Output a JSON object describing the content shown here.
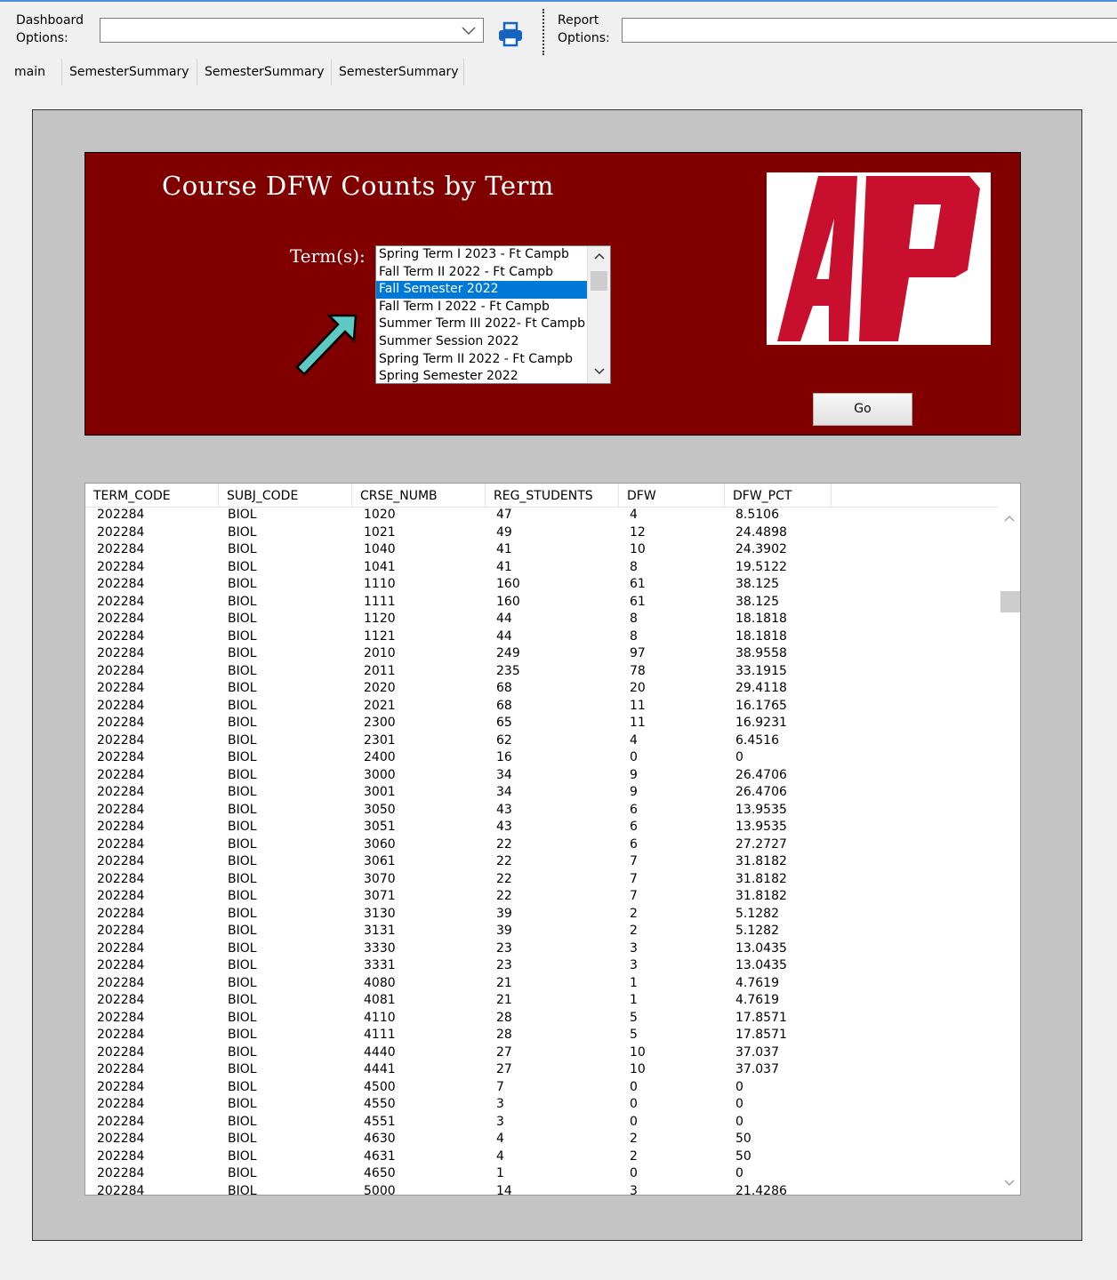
{
  "toolbar": {
    "dashboard_label_1": "Dashboard",
    "dashboard_label_2": "Options:",
    "dashboard_value": "",
    "report_label_1": "Report",
    "report_label_2": "Options:",
    "report_value": ""
  },
  "tabs": [
    "main",
    "SemesterSummary",
    "SemesterSummary",
    "SemesterSummary"
  ],
  "panel": {
    "title": "Course DFW Counts by Term",
    "terms_label": "Term(s):",
    "go_label": "Go",
    "terms": [
      "Spring Term I 2023 - Ft Campb",
      "Fall Term II 2022 - Ft Campb",
      "Fall Semester 2022",
      "Fall Term I 2022 - Ft Campb",
      "Summer Term III 2022- Ft Campb",
      "Summer Session 2022",
      "Spring Term II 2022 - Ft Campb",
      "Spring Semester 2022"
    ],
    "selected_term_index": 2,
    "accent_color": "#800000",
    "logo_color": "#c8102e"
  },
  "grid": {
    "columns": [
      "TERM_CODE",
      "SUBJ_CODE",
      "CRSE_NUMB",
      "REG_STUDENTS",
      "DFW",
      "DFW_PCT"
    ],
    "rows": [
      [
        "202284",
        "BIOL",
        "1020",
        "47",
        "4",
        "8.5106"
      ],
      [
        "202284",
        "BIOL",
        "1021",
        "49",
        "12",
        "24.4898"
      ],
      [
        "202284",
        "BIOL",
        "1040",
        "41",
        "10",
        "24.3902"
      ],
      [
        "202284",
        "BIOL",
        "1041",
        "41",
        "8",
        "19.5122"
      ],
      [
        "202284",
        "BIOL",
        "1110",
        "160",
        "61",
        "38.125"
      ],
      [
        "202284",
        "BIOL",
        "1111",
        "160",
        "61",
        "38.125"
      ],
      [
        "202284",
        "BIOL",
        "1120",
        "44",
        "8",
        "18.1818"
      ],
      [
        "202284",
        "BIOL",
        "1121",
        "44",
        "8",
        "18.1818"
      ],
      [
        "202284",
        "BIOL",
        "2010",
        "249",
        "97",
        "38.9558"
      ],
      [
        "202284",
        "BIOL",
        "2011",
        "235",
        "78",
        "33.1915"
      ],
      [
        "202284",
        "BIOL",
        "2020",
        "68",
        "20",
        "29.4118"
      ],
      [
        "202284",
        "BIOL",
        "2021",
        "68",
        "11",
        "16.1765"
      ],
      [
        "202284",
        "BIOL",
        "2300",
        "65",
        "11",
        "16.9231"
      ],
      [
        "202284",
        "BIOL",
        "2301",
        "62",
        "4",
        "6.4516"
      ],
      [
        "202284",
        "BIOL",
        "2400",
        "16",
        "0",
        "0"
      ],
      [
        "202284",
        "BIOL",
        "3000",
        "34",
        "9",
        "26.4706"
      ],
      [
        "202284",
        "BIOL",
        "3001",
        "34",
        "9",
        "26.4706"
      ],
      [
        "202284",
        "BIOL",
        "3050",
        "43",
        "6",
        "13.9535"
      ],
      [
        "202284",
        "BIOL",
        "3051",
        "43",
        "6",
        "13.9535"
      ],
      [
        "202284",
        "BIOL",
        "3060",
        "22",
        "6",
        "27.2727"
      ],
      [
        "202284",
        "BIOL",
        "3061",
        "22",
        "7",
        "31.8182"
      ],
      [
        "202284",
        "BIOL",
        "3070",
        "22",
        "7",
        "31.8182"
      ],
      [
        "202284",
        "BIOL",
        "3071",
        "22",
        "7",
        "31.8182"
      ],
      [
        "202284",
        "BIOL",
        "3130",
        "39",
        "2",
        "5.1282"
      ],
      [
        "202284",
        "BIOL",
        "3131",
        "39",
        "2",
        "5.1282"
      ],
      [
        "202284",
        "BIOL",
        "3330",
        "23",
        "3",
        "13.0435"
      ],
      [
        "202284",
        "BIOL",
        "3331",
        "23",
        "3",
        "13.0435"
      ],
      [
        "202284",
        "BIOL",
        "4080",
        "21",
        "1",
        "4.7619"
      ],
      [
        "202284",
        "BIOL",
        "4081",
        "21",
        "1",
        "4.7619"
      ],
      [
        "202284",
        "BIOL",
        "4110",
        "28",
        "5",
        "17.8571"
      ],
      [
        "202284",
        "BIOL",
        "4111",
        "28",
        "5",
        "17.8571"
      ],
      [
        "202284",
        "BIOL",
        "4440",
        "27",
        "10",
        "37.037"
      ],
      [
        "202284",
        "BIOL",
        "4441",
        "27",
        "10",
        "37.037"
      ],
      [
        "202284",
        "BIOL",
        "4500",
        "7",
        "0",
        "0"
      ],
      [
        "202284",
        "BIOL",
        "4550",
        "3",
        "0",
        "0"
      ],
      [
        "202284",
        "BIOL",
        "4551",
        "3",
        "0",
        "0"
      ],
      [
        "202284",
        "BIOL",
        "4630",
        "4",
        "2",
        "50"
      ],
      [
        "202284",
        "BIOL",
        "4631",
        "4",
        "2",
        "50"
      ],
      [
        "202284",
        "BIOL",
        "4650",
        "1",
        "0",
        "0"
      ],
      [
        "202284",
        "BIOL",
        "5000",
        "14",
        "3",
        "21.4286"
      ]
    ]
  }
}
